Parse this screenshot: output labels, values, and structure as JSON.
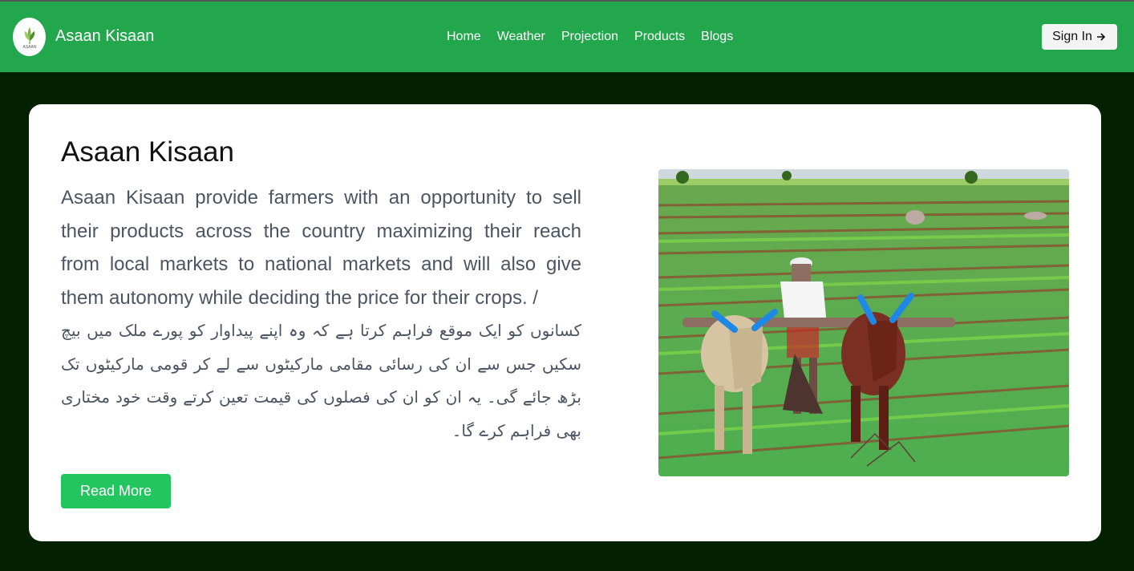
{
  "navbar": {
    "brand": "Asaan Kisaan",
    "logo_text": "ASAAN",
    "links": [
      "Home",
      "Weather",
      "Projection",
      "Products",
      "Blogs"
    ],
    "signin_label": "Sign In",
    "signin_icon": "arrow-right-icon"
  },
  "card": {
    "title": "Asaan Kisaan",
    "description": "Asaan Kisaan provide farmers with an opportunity to sell their products across the country maximizing their reach from local markets to national markets and will also give them autonomy while deciding the price for their crops. /",
    "description_urdu": "کسانوں کو ایک موقع فراہم کرتا ہے کہ وہ اپنے پیداوار کو پورے ملک میں بیچ سکیں جس سے ان کی رسائی مقامی مارکیٹوں سے لے کر قومی مارکیٹوں تک بڑھ جائے گی۔ یہ ان کو ان کی فصلوں کی قیمت تعین کرتے وقت خود مختاری بھی فراہم کرے گا۔",
    "read_more_label": "Read More",
    "image": "farmer-plowing-field-with-oxen"
  },
  "colors": {
    "navbar": "#22a74c",
    "page_bg": "#032000",
    "button": "#22c55e"
  }
}
